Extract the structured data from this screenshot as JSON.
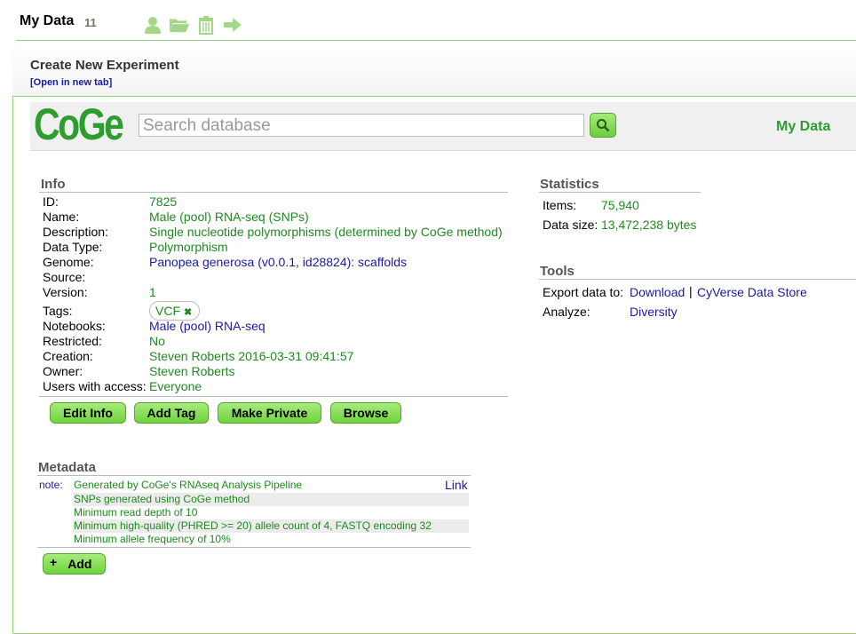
{
  "header": {
    "title": "My Data",
    "count": "11"
  },
  "toolbar_icons": [
    "user-icon",
    "folder-icon",
    "trash-icon",
    "arrow-right-icon"
  ],
  "panel": {
    "title": "Create New Experiment",
    "open_link": "[Open in new tab]"
  },
  "coge": {
    "logo": "CoGe",
    "search_placeholder": "Search database",
    "my_data": "My Data"
  },
  "info": {
    "heading": "Info",
    "labels": {
      "id": "ID:",
      "name": "Name:",
      "description": "Description:",
      "data_type": "Data Type:",
      "genome": "Genome:",
      "source": "Source:",
      "version": "Version:",
      "tags": "Tags:",
      "notebooks": "Notebooks:",
      "restricted": "Restricted:",
      "creation": "Creation:",
      "owner": "Owner:",
      "users": "Users with access:"
    },
    "values": {
      "id": "7825",
      "name": "Male (pool) RNA-seq (SNPs)",
      "description": "Single nucleotide polymorphisms (determined by CoGe method)",
      "data_type": "Polymorphism",
      "genome": "Panopea generosa (v0.0.1, id28824): scaffolds",
      "source": "",
      "version": "1",
      "tag": "VCF",
      "notebooks": "Male (pool) RNA-seq",
      "restricted": "No",
      "creation": "Steven Roberts 2016-03-31 09:41:57",
      "owner": "Steven Roberts",
      "users": "Everyone"
    },
    "buttons": {
      "edit": "Edit Info",
      "add_tag": "Add Tag",
      "make_private": "Make Private",
      "browse": "Browse"
    }
  },
  "statistics": {
    "heading": "Statistics",
    "items_label": "Items:",
    "items_value": "75,940",
    "size_label": "Data size:",
    "size_value": "13,472,238 bytes"
  },
  "tools": {
    "heading": "Tools",
    "export_label": "Export data to:",
    "download": "Download",
    "separator": "|",
    "cyverse": "CyVerse Data Store",
    "analyze_label": "Analyze:",
    "diversity": "Diversity"
  },
  "metadata": {
    "heading": "Metadata",
    "key": "note:",
    "link": "Link",
    "lines": [
      "Generated by CoGe's RNAseq Analysis Pipeline",
      "SNPs generated using CoGe method",
      "Minimum read depth of 10",
      "Minimum high-quality (PHRED >= 20) allele count of 4, FASTQ encoding 32",
      "Minimum allele frequency of 10%"
    ],
    "add_plus": "+",
    "add_label": "Add"
  },
  "colors": {
    "accent": "#2d9d2d",
    "button": "#7fdc4e",
    "link": "#1a1aa6"
  }
}
